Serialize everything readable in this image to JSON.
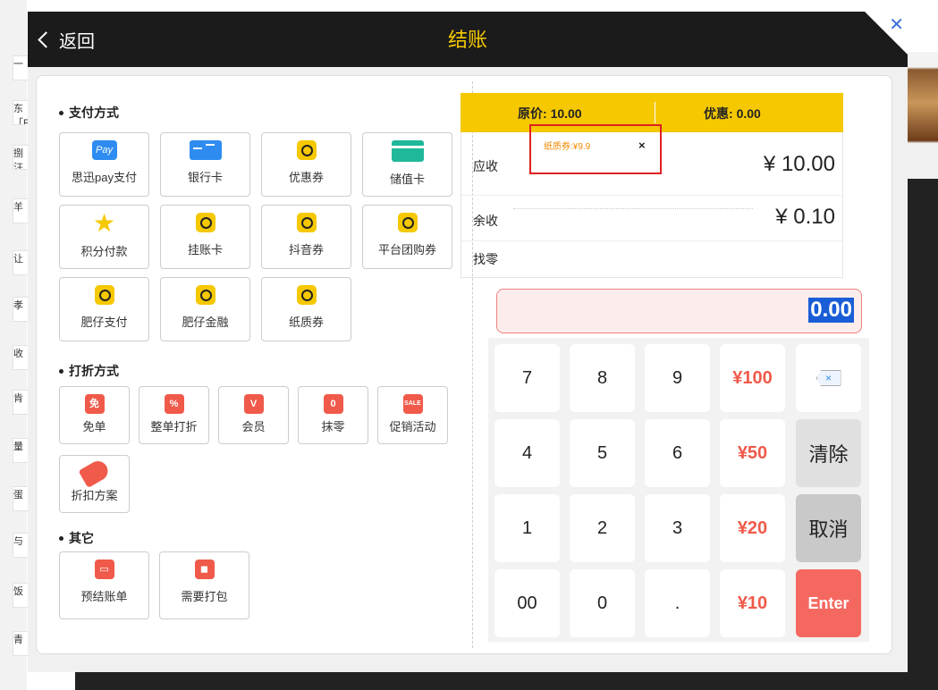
{
  "header": {
    "back_label": "返回",
    "title": "结账"
  },
  "background": {
    "left_chars": [
      "",
      "一",
      "东\n「F",
      "捌\n汪",
      "羊",
      "让",
      "孝",
      "收",
      "肯",
      "量",
      "蛋",
      "与",
      "饭",
      "青"
    ]
  },
  "sections": {
    "payment": {
      "title": "支付方式",
      "items": [
        {
          "label": "思迅pay支付",
          "icon": "pay-icon",
          "icon_text": "Pay"
        },
        {
          "label": "银行卡",
          "icon": "bank-card-icon"
        },
        {
          "label": "优惠券",
          "icon": "coupon-icon"
        },
        {
          "label": "储值卡",
          "icon": "stored-value-card-icon"
        },
        {
          "label": "积分付款",
          "icon": "star-icon"
        },
        {
          "label": "挂账卡",
          "icon": "coupon-icon"
        },
        {
          "label": "抖音券",
          "icon": "coupon-icon"
        },
        {
          "label": "平台团购券",
          "icon": "coupon-icon"
        },
        {
          "label": "肥仔支付",
          "icon": "coupon-icon"
        },
        {
          "label": "肥仔金融",
          "icon": "coupon-icon"
        },
        {
          "label": "纸质券",
          "icon": "coupon-icon"
        }
      ]
    },
    "discount": {
      "title": "打折方式",
      "items": [
        {
          "label": "免单",
          "icon": "free-order-icon"
        },
        {
          "label": "整单打折",
          "icon": "percent-icon"
        },
        {
          "label": "会员",
          "icon": "member-icon"
        },
        {
          "label": "抹零",
          "icon": "round-off-icon"
        },
        {
          "label": "促销活动",
          "icon": "sale-icon",
          "icon_text": "SALE"
        },
        {
          "label": "折扣方案",
          "icon": "tag-icon"
        }
      ]
    },
    "other": {
      "title": "其它",
      "items": [
        {
          "label": "预结账单",
          "icon": "wallet-icon"
        },
        {
          "label": "需要打包",
          "icon": "bag-icon"
        }
      ]
    }
  },
  "summary": {
    "original_label": "原价:",
    "original_value": "10.00",
    "discount_label": "优惠:",
    "discount_value": "0.00",
    "due_label": "应收",
    "due_value": "¥ 10.00",
    "remaining_label": "余收",
    "remaining_value": "¥ 0.10",
    "change_label": "找零",
    "coupon_tag_text": "纸质券:¥9.9",
    "coupon_tag_close": "×"
  },
  "input": {
    "value": "0.00"
  },
  "keypad": {
    "rows": [
      [
        "7",
        "8",
        "9",
        "¥100",
        "backspace"
      ],
      [
        "4",
        "5",
        "6",
        "¥50",
        "清除"
      ],
      [
        "1",
        "2",
        "3",
        "¥20",
        "取消"
      ],
      [
        "00",
        "0",
        ".",
        "¥10",
        "Enter"
      ]
    ]
  },
  "colors": {
    "accent_yellow": "#f5c800",
    "header_bg": "#1b1b1b",
    "red": "#f05a4a",
    "blue_highlight": "#1a5dd6"
  }
}
